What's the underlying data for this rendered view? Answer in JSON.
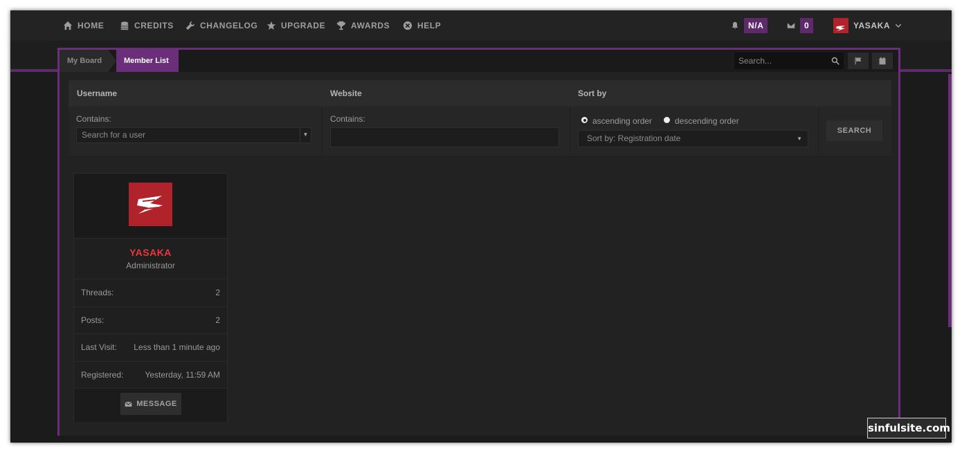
{
  "nav": {
    "items": [
      {
        "label": "HOME",
        "icon": "home-icon"
      },
      {
        "label": "CREDITS",
        "icon": "coins-icon"
      },
      {
        "label": "CHANGELOG",
        "icon": "wrench-icon"
      },
      {
        "label": "UPGRADE",
        "icon": "star-icon"
      },
      {
        "label": "AWARDS",
        "icon": "trophy-icon"
      },
      {
        "label": "HELP",
        "icon": "help-icon"
      }
    ],
    "notifications_badge": "N/A",
    "messages_badge": "0",
    "username": "YASAKA"
  },
  "breadcrumb": {
    "home": "My Board",
    "current": "Member List"
  },
  "header_search": {
    "placeholder": "Search..."
  },
  "filters": {
    "username_header": "Username",
    "website_header": "Website",
    "sortby_header": "Sort by",
    "username_label": "Contains:",
    "username_placeholder": "Search for a user",
    "website_label": "Contains:",
    "ascending": "ascending order",
    "descending": "descending order",
    "sort_select": "Sort by: Registration date",
    "search_button": "SEARCH"
  },
  "member": {
    "name": "YASAKA",
    "role": "Administrator",
    "threads_label": "Threads:",
    "threads": "2",
    "posts_label": "Posts:",
    "posts": "2",
    "last_visit_label": "Last Visit:",
    "last_visit": "Less than 1 minute ago",
    "registered_label": "Registered:",
    "registered": "Yesterday, 11:59 AM",
    "message_button": "MESSAGE"
  },
  "watermark": "sinfulsite.com",
  "colors": {
    "accent": "#6b2e7a",
    "brand_red": "#b0232a",
    "username_red": "#e8383d"
  }
}
